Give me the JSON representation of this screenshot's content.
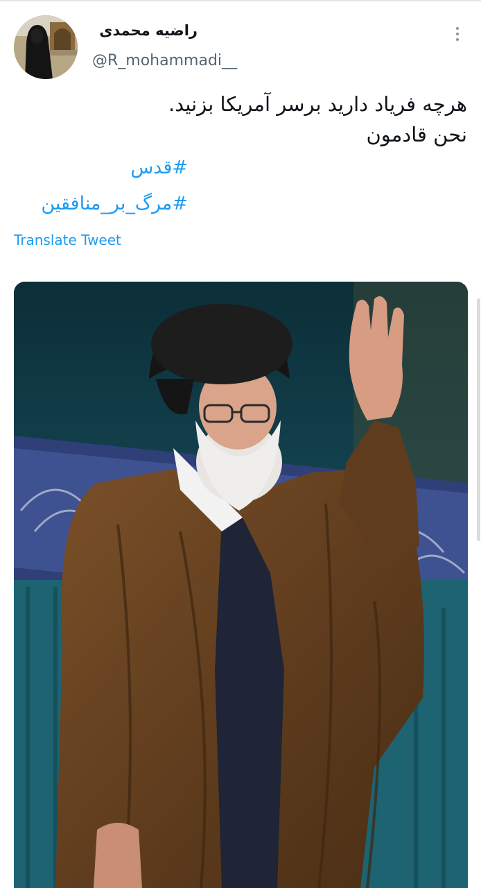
{
  "tweet": {
    "author": {
      "display_name": "راضیه محمدی",
      "handle": "@R_mohammadi__"
    },
    "text_lines": [
      "هرچه فریاد دارید برسر آمریکا بزنید.",
      "نحن قادمون"
    ],
    "hashtags": [
      "#قدس",
      "#مرگ_بر_منافقین"
    ],
    "translate_label": "Translate Tweet",
    "more_icon": "more-vertical-icon"
  },
  "colors": {
    "link": "#1d9bf0",
    "text": "#0f1419",
    "secondary": "#536471",
    "robe": "#6b4522",
    "turban": "#1b1b1b",
    "background_curtain": "#1e5f6b"
  }
}
